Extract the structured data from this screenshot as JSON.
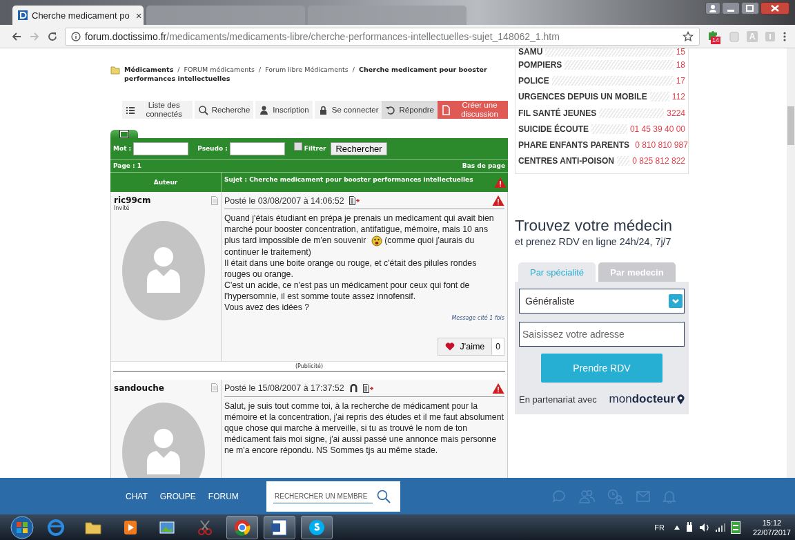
{
  "browser": {
    "tabs": [
      {
        "title": "Cherche medicament po",
        "selected": true
      },
      {
        "selected": false
      },
      {
        "selected": false
      }
    ],
    "close_glyph": "×",
    "url_host": "forum.doctissimo.fr",
    "url_path": "/medicaments/medicaments-libre/cherche-performances-intellectuelles-sujet_148062_1.htm",
    "extension_badge": "14",
    "extension_letter": "A"
  },
  "breadcrumb": "**Médicaments**  /  FORUM médicaments  /  Forum libre Médicaments  /  **Cherche medicament pour booster performances intellectuelles**",
  "toolbar": [
    {
      "label": "Liste des connectés",
      "kind": "plain"
    },
    {
      "label": "Recherche",
      "kind": "plain"
    },
    {
      "label": "Inscription",
      "kind": "plain"
    },
    {
      "label": "Se connecter",
      "kind": "plain"
    },
    {
      "label": "Répondre",
      "kind": "muted"
    },
    {
      "label": "Créer une discussion",
      "kind": "accent"
    }
  ],
  "forum_search": {
    "word_label": "Mot :",
    "pseudo_label": "Pseudo :",
    "filter_label": "Filtrer",
    "filter_checked": false,
    "button": "Rechercher"
  },
  "page_label": "Page : 1",
  "bottom_link": "Bas de page",
  "author_header": "Auteur",
  "subject_header": "Sujet : Cherche medicament pour booster performances intellectuelles",
  "posts": [
    {
      "author": "ric99cm",
      "role": "Invité",
      "date": "Posté le 03/08/2007 à 14:06:52",
      "profile_icon": false,
      "paragraphs": [
        [
          "Quand j'étais étudiant en prépa je prenais un medicament qui avait bien marché pour booster concentration, antifatigue, mémoire, mais 10 ans plus tard impossible de m'en souvenir",
          "(comme quoi j'aurais du continuer le traitement)"
        ],
        [
          "Il était dans une boite orange ou rouge, et c'était des pilules rondes rouges ou orange."
        ],
        [
          "C'est un acide, ce n'est pas un médicament pour ceux qui font de l'hypersomnie, il est somme toute assez innofensif."
        ],
        [
          "Vous avez des idées ?"
        ]
      ],
      "quoted": "Message cité 1 fois",
      "like_label": "J'aime",
      "like_count": "0"
    },
    {
      "author": "sandouche",
      "date": "Posté le 15/08/2007 à 17:37:52",
      "profile_icon": true,
      "paragraphs": [
        [
          "Salut, je suis tout comme toi, à la recherche de médicament pour la mémoire et la concentration, j'ai repris des études et il me faut absolument qque chose qui marche à merveille, si tu as trouvé le nom de ton médicament fais moi signe, j'ai aussi passé une annonce mais personne ne m'a encore répondu. NS Sommes tjs au même stade."
        ]
      ]
    }
  ],
  "ad_label": "(Publicité)",
  "emergency": [
    {
      "name": "SAMU",
      "number": "15"
    },
    {
      "name": "POMPIERS",
      "number": "18"
    },
    {
      "name": "POLICE",
      "number": "17"
    },
    {
      "name": "URGENCES DEPUIS UN MOBILE",
      "number": "112"
    },
    {
      "name": "FIL SANTÉ JEUNES",
      "number": "3224"
    },
    {
      "name": "SUICIDE ÉCOUTE",
      "number": "01 45 39 40 00"
    },
    {
      "name": "PHARE ENFANTS PARENTS",
      "number": "0 810 810 987"
    },
    {
      "name": "CENTRES ANTI-POISON",
      "number": "0 825 812 822"
    }
  ],
  "doctor": {
    "title": "Trouvez votre médecin",
    "subtitle": "et prenez RDV en ligne 24h/24, 7j/7",
    "tabs": [
      {
        "label": "Par spécialité",
        "selected": true
      },
      {
        "label": "Par medecin",
        "selected": false
      }
    ],
    "specialty": "Généraliste",
    "address_placeholder": "Saisissez votre adresse",
    "button": "Prendre RDV",
    "partner": "En partenariat avec",
    "logo": "mon**docteur**"
  },
  "bottom_bar": {
    "nav": [
      "CHAT",
      "GROUPE",
      "FORUM"
    ],
    "member_search_placeholder": "RECHERCHER UN MEMBRE"
  },
  "taskbar": {
    "apps": [
      {
        "kind": "ie",
        "running": false
      },
      {
        "kind": "folder",
        "running": false
      },
      {
        "kind": "media",
        "running": false
      },
      {
        "kind": "photos",
        "running": false
      },
      {
        "kind": "snip",
        "running": false
      },
      {
        "kind": "chrome",
        "running": true
      },
      {
        "kind": "word",
        "running": true
      },
      {
        "kind": "skype",
        "running": true
      }
    ],
    "language": "FR",
    "time": "15:12",
    "date": "22/07/2017"
  }
}
